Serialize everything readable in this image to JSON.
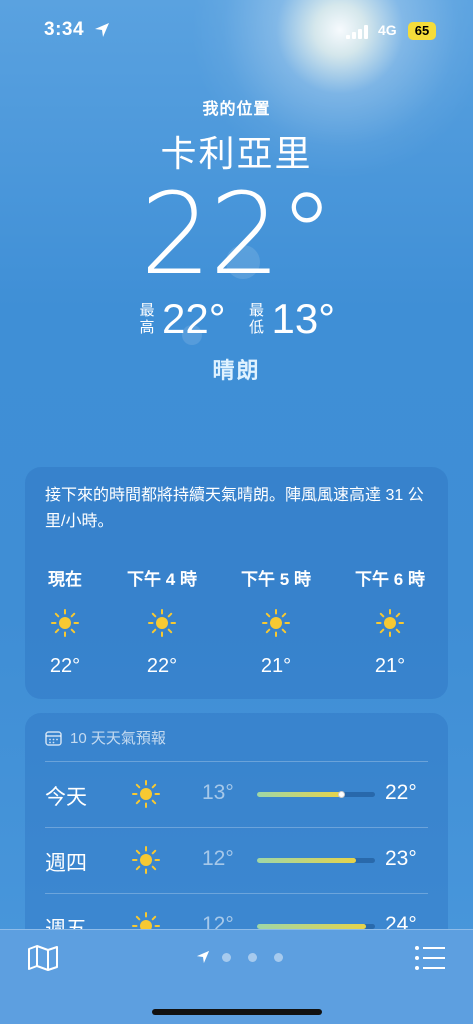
{
  "status_bar": {
    "time": "3:34",
    "network": "4G",
    "battery": "65"
  },
  "header": {
    "my_location": "我的位置",
    "city": "卡利亞里",
    "current_temp": "22°",
    "high_label": "最高",
    "high": "22°",
    "low_label": "最低",
    "low": "13°",
    "condition": "晴朗"
  },
  "hourly": {
    "summary": "接下來的時間都將持續天氣晴朗。陣風風速高達 31 公里/小時。",
    "hours": [
      {
        "label": "現在",
        "icon": "sun-icon",
        "temp": "22°"
      },
      {
        "label": "下午 4 時",
        "icon": "sun-icon",
        "temp": "22°"
      },
      {
        "label": "下午 5 時",
        "icon": "sun-icon",
        "temp": "21°"
      },
      {
        "label": "下午 6 時",
        "icon": "sun-icon",
        "temp": "21°"
      }
    ]
  },
  "daily": {
    "title": "10 天天氣預報",
    "days": [
      {
        "name": "今天",
        "icon": "sun-icon",
        "low": "13°",
        "high": "22°",
        "range_start": 0.0,
        "range_end": 0.72,
        "current_marker": 0.72
      },
      {
        "name": "週四",
        "icon": "sun-icon",
        "low": "12°",
        "high": "23°",
        "range_start": 0.0,
        "range_end": 0.84
      },
      {
        "name": "週五",
        "icon": "sun-icon",
        "low": "12°",
        "high": "24°",
        "range_start": 0.0,
        "range_end": 0.92
      }
    ]
  },
  "colors": {
    "sun": "#f7c932",
    "battery": "#f5dc3a",
    "accent_text": "#dff2ff"
  }
}
